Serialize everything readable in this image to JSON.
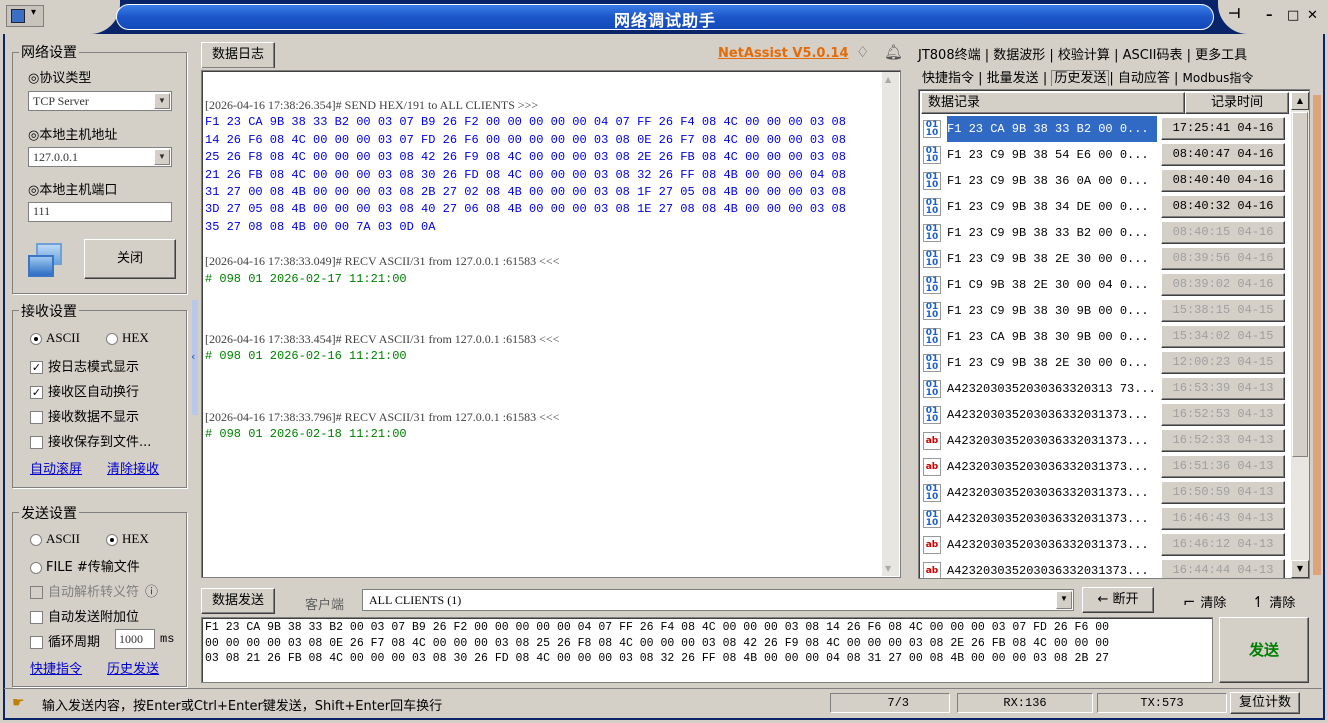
{
  "window": {
    "title": "网络调试助手",
    "controls": [
      "pin-icon",
      "minimize-icon",
      "maximize-icon",
      "close-icon"
    ]
  },
  "network_settings": {
    "group_title": "网络设置",
    "protocol_label": "◎协议类型",
    "protocol_value": "TCP Server",
    "host_label": "◎本地主机地址",
    "host_value": "127.0.0.1",
    "port_label": "◎本地主机端口",
    "port_value": "111",
    "close_button": "关闭"
  },
  "receive_settings": {
    "group_title": "接收设置",
    "ascii_label": "ASCII",
    "hex_label": "HEX",
    "selected": "ASCII",
    "options": [
      {
        "label": "按日志模式显示",
        "checked": true
      },
      {
        "label": "接收区自动换行",
        "checked": true
      },
      {
        "label": "接收数据不显示",
        "checked": false
      },
      {
        "label": "接收保存到文件...",
        "checked": false
      }
    ],
    "auto_scroll_link": "自动滚屏",
    "clear_link": "清除接收"
  },
  "send_settings": {
    "group_title": "发送设置",
    "ascii_label": "ASCII",
    "hex_label": "HEX",
    "selected": "HEX",
    "file_label": "FILE #传输文件",
    "options": [
      {
        "label": "自动解析转义符",
        "checked": false,
        "disabled": true
      },
      {
        "label": "自动发送附加位",
        "checked": false
      },
      {
        "label": "循环周期",
        "checked": false
      }
    ],
    "cycle_value": "1000",
    "cycle_unit": "ms",
    "quick_cmd_link": "快捷指令",
    "history_link": "历史发送"
  },
  "data_log": {
    "tab_label": "数据日志",
    "version_link": "NetAssist V5.0.14",
    "entries": [
      {
        "header": "[2026-04-16 17:38:26.354]# SEND HEX/191 to ALL CLIENTS >>>",
        "color": "#0000e0",
        "lines": [
          "F1 23 CA 9B 38 33 B2 00 03 07 B9 26 F2 00 00 00 00 00 04 07 FF 26 F4 08 4C 00 00 00 03 08",
          "14 26 F6 08 4C 00 00 00 03 07 FD 26 F6 00 00 00 00 00 03 08 0E 26 F7 08 4C 00 00 00 03 08",
          "25 26 F8 08 4C 00 00 00 03 08 42 26 F9 08 4C 00 00 00 03 08 2E 26 FB 08 4C 00 00 00 03 08",
          "21 26 FB 08 4C 00 00 00 03 08 30 26 FD 08 4C 00 00 00 03 08 32 26 FF 08 4B 00 00 00 04 08",
          "31 27 00 08 4B 00 00 00 03 08 2B 27 02 08 4B 00 00 00 03 08 1F 27 05 08 4B 00 00 00 03 08",
          "3D 27 05 08 4B 00 00 00 03 08 40 27 06 08 4B 00 00 00 03 08 1E 27 08 08 4B 00 00 00 03 08",
          "35 27 08 08 4B 00 00 7A 03 0D 0A"
        ]
      },
      {
        "header": "[2026-04-16 17:38:33.049]# RECV ASCII/31 from 127.0.0.1 :61583 <<<",
        "color": "#008000",
        "lines": [
          "# 098 01 2026-02-17 11:21:00"
        ]
      },
      {
        "header": "[2026-04-16 17:38:33.454]# RECV ASCII/31 from 127.0.0.1 :61583 <<<",
        "color": "#008000",
        "lines": [
          "# 098 01 2026-02-16 11:21:00"
        ]
      },
      {
        "header": "[2026-04-16 17:38:33.796]# RECV ASCII/31 from 127.0.0.1 :61583 <<<",
        "color": "#008000",
        "lines": [
          "# 098 01 2026-02-18 11:21:00"
        ]
      }
    ]
  },
  "right_panel": {
    "tabs_row1": [
      "JT808终端",
      "数据波形",
      "校验计算",
      "ASCII码表",
      "更多工具"
    ],
    "tabs_row2": [
      "快捷指令",
      "批量发送",
      "历史发送",
      "自动应答",
      "Modbus指令"
    ],
    "active_tab": "历史发送",
    "col_record": "数据记录",
    "col_time": "记录时间",
    "rows": [
      {
        "icon": "hex",
        "text": "F1 23 CA 9B 38 33 B2 00 0...",
        "time": "17:25:41 04-16",
        "selected": true,
        "dim": false
      },
      {
        "icon": "hex",
        "text": "F1 23 C9 9B 38 54 E6 00 0...",
        "time": "08:40:47 04-16",
        "selected": false,
        "dim": false
      },
      {
        "icon": "hex",
        "text": "F1 23 C9 9B 38 36 0A 00 0...",
        "time": "08:40:40 04-16",
        "selected": false,
        "dim": false
      },
      {
        "icon": "hex",
        "text": "F1 23 C9 9B 38 34 DE 00 0...",
        "time": "08:40:32 04-16",
        "selected": false,
        "dim": false
      },
      {
        "icon": "hex",
        "text": "F1 23 C9 9B 38 33 B2 00 0...",
        "time": "08:40:15 04-16",
        "selected": false,
        "dim": true
      },
      {
        "icon": "hex",
        "text": "F1 23 C9 9B 38 2E 30 00 0...",
        "time": "08:39:56 04-16",
        "selected": false,
        "dim": true
      },
      {
        "icon": "hex",
        "text": "F1 C9 9B 38 2E 30 00 04 0...",
        "time": "08:39:02 04-16",
        "selected": false,
        "dim": true
      },
      {
        "icon": "hex",
        "text": "F1 23 C9 9B 38 30 9B 00 0...",
        "time": "15:38:15 04-15",
        "selected": false,
        "dim": true
      },
      {
        "icon": "hex",
        "text": "F1 23 CA 9B 38 30 9B 00 0...",
        "time": "15:34:02 04-15",
        "selected": false,
        "dim": true
      },
      {
        "icon": "hex",
        "text": "F1 23 C9 9B 38 2E 30 00 0...",
        "time": "12:00:23 04-15",
        "selected": false,
        "dim": true
      },
      {
        "icon": "hex",
        "text": "A4232030352030363320313 73...",
        "time": "16:53:39 04-13",
        "selected": false,
        "dim": true
      },
      {
        "icon": "hex",
        "text": "A423203035203036332031373...",
        "time": "16:52:53 04-13",
        "selected": false,
        "dim": true
      },
      {
        "icon": "ab",
        "text": "A423203035203036332031373...",
        "time": "16:52:33 04-13",
        "selected": false,
        "dim": true
      },
      {
        "icon": "ab",
        "text": "A423203035203036332031373...",
        "time": "16:51:36 04-13",
        "selected": false,
        "dim": true
      },
      {
        "icon": "hex",
        "text": "A423203035203036332031373...",
        "time": "16:50:59 04-13",
        "selected": false,
        "dim": true
      },
      {
        "icon": "hex",
        "text": "A423203035203036332031373...",
        "time": "16:46:43 04-13",
        "selected": false,
        "dim": true
      },
      {
        "icon": "ab",
        "text": "A423203035203036332031373...",
        "time": "16:46:12 04-13",
        "selected": false,
        "dim": true
      },
      {
        "icon": "ab",
        "text": "A423203035203036332031373...",
        "time": "16:44:44 04-13",
        "selected": false,
        "dim": true
      }
    ]
  },
  "data_send": {
    "tab_label": "数据发送",
    "client_label": "客户端",
    "client_value": "ALL CLIENTS (1)",
    "disconnect_button": "断开",
    "clear1_button": "清除",
    "clear2_button": "清除",
    "send_button": "发送",
    "content_lines": [
      "F1 23 CA 9B 38 33 B2 00 03 07 B9 26 F2 00 00 00 00 00 04 07 FF 26 F4 08 4C 00 00 00 03 08 14 26 F6 08 4C 00 00 00 03 07 FD 26 F6 00",
      "00 00 00 00 03 08 0E 26 F7 08 4C 00 00 00 03 08 25 26 F8 08 4C 00 00 00 03 08 42 26 F9 08 4C 00 00 00 03 08 2E 26 FB 08 4C 00 00 00",
      "03 08 21 26 FB 08 4C 00 00 00 03 08 30 26 FD 08 4C 00 00 00 03 08 32 26 FF 08 4B 00 00 00 04 08 31 27 00 08 4B 00 00 00 03 08 2B 27"
    ]
  },
  "status_bar": {
    "hint": "输入发送内容，按Enter或Ctrl+Enter键发送，Shift+Enter回车换行",
    "page": "7/3",
    "rx": "RX:136",
    "tx": "TX:573",
    "reset_button": "复位计数"
  }
}
